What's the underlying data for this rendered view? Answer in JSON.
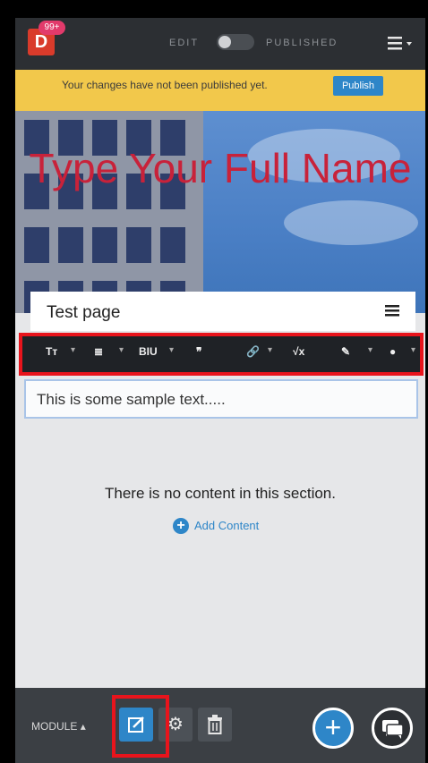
{
  "app": {
    "logo_letter": "D",
    "notification_count": "99+"
  },
  "header": {
    "edit_label": "EDIT",
    "published_label": "PUBLISHED"
  },
  "banner": {
    "message": "Your changes have not been published yet.",
    "publish_label": "Publish",
    "color": "#f2c84b"
  },
  "hero": {
    "title": "Type Your Full Name"
  },
  "page": {
    "title": "Test page"
  },
  "toolbar": {
    "items": [
      {
        "label": "Tт",
        "icon": "text-size-icon"
      },
      {
        "label": "≣",
        "icon": "list-icon"
      },
      {
        "label": "BIU",
        "icon": "text-style-icon"
      },
      {
        "label": "❞",
        "icon": "quote-icon"
      },
      {
        "label": "🔗",
        "icon": "link-icon"
      },
      {
        "label": "√x",
        "icon": "formula-icon"
      },
      {
        "label": "✎",
        "icon": "paint-icon"
      },
      {
        "label": "●",
        "icon": "info-icon"
      }
    ]
  },
  "editor": {
    "text": "This is some sample text....."
  },
  "section": {
    "empty_message": "There is no content in this section.",
    "add_label": "Add Content"
  },
  "bottom": {
    "module_label": "MODULE"
  },
  "colors": {
    "accent": "#2e86c8",
    "highlight": "#e8141c",
    "title_red": "#c8223a"
  }
}
